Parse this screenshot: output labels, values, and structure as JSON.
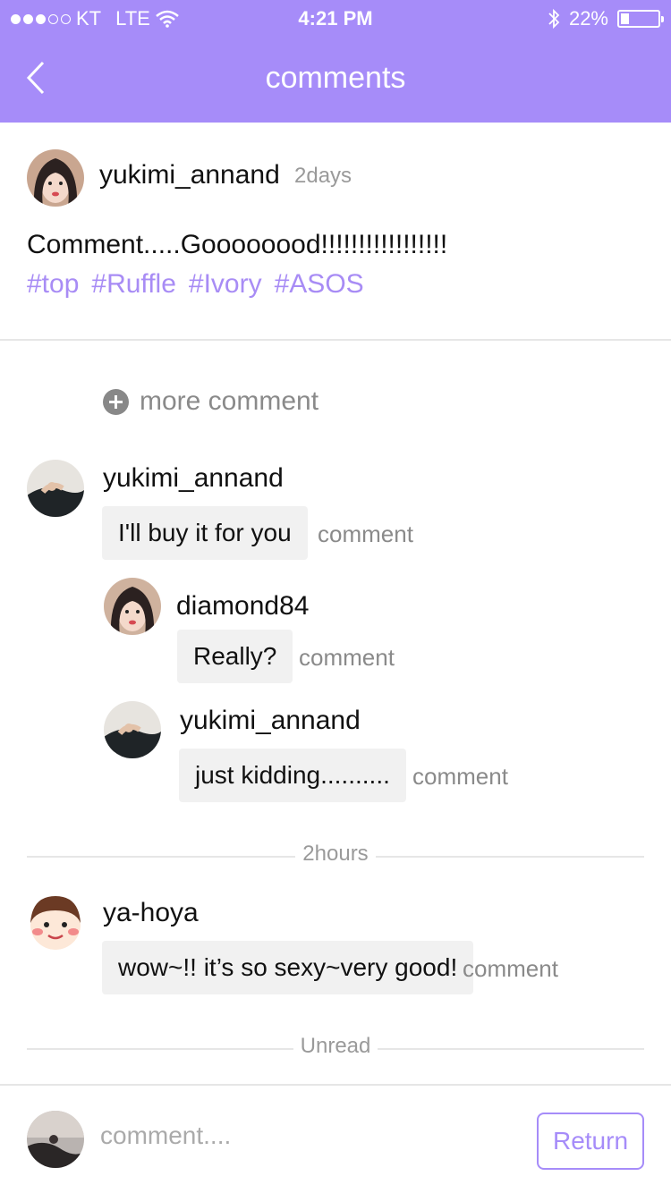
{
  "status_bar": {
    "carrier": "KT",
    "network": "LTE",
    "time": "4:21 PM",
    "battery_label": "22%",
    "battery_level": 0.22,
    "signal_bars_filled": 3,
    "signal_bars_total": 5
  },
  "nav": {
    "title": "comments"
  },
  "post": {
    "username": "yukimi_annand",
    "time": "2days",
    "text": "Comment.....Goooooood!!!!!!!!!!!!!!!!!",
    "tags": [
      "#top",
      "#Ruffle",
      "#Ivory",
      "#ASOS"
    ]
  },
  "more_comment_label": "more comment",
  "comments": [
    {
      "username": "yukimi_annand",
      "text": "I'll buy it for you",
      "action": "comment"
    },
    {
      "username": "diamond84",
      "text": "Really?",
      "action": "comment"
    },
    {
      "username": "yukimi_annand",
      "text": "just kidding..........",
      "action": "comment"
    },
    {
      "username": "ya-hoya",
      "text": "wow~!! it’s so sexy~very good!",
      "action": "comment"
    }
  ],
  "dividers": {
    "time": "2hours",
    "unread": "Unread"
  },
  "composer": {
    "placeholder": "comment....",
    "button": "Return"
  },
  "colors": {
    "accent": "#a68cf9",
    "tag": "#a88cf5",
    "bubble": "#f1f1f1"
  }
}
